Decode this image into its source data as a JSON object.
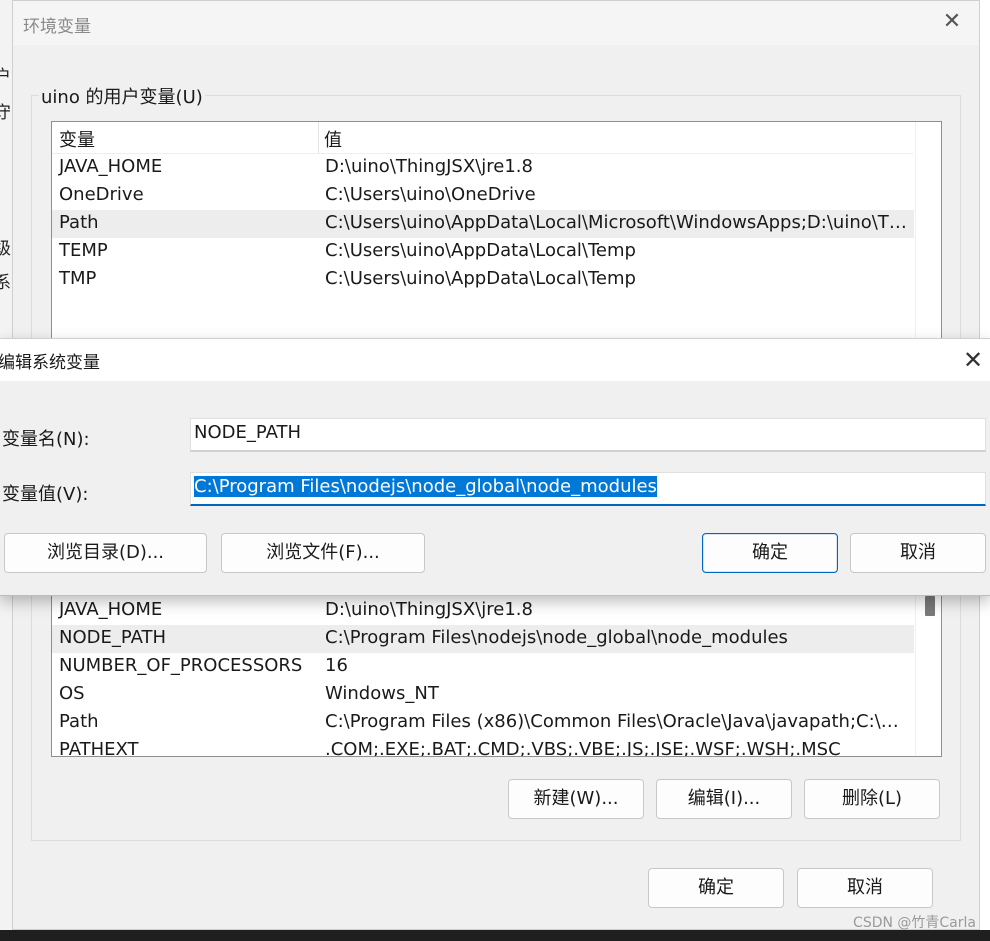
{
  "background": {
    "glyphs": [
      "户",
      "守",
      "级",
      "系"
    ]
  },
  "env_window": {
    "title": "环境变量",
    "close_glyph": "✕",
    "user_group_label": "uino 的用户变量(U)",
    "user_vars": {
      "columns": [
        "变量",
        "值"
      ],
      "rows": [
        {
          "name": "JAVA_HOME",
          "value": "D:\\uino\\ThingJSX\\jre1.8"
        },
        {
          "name": "OneDrive",
          "value": "C:\\Users\\uino\\OneDrive"
        },
        {
          "name": "Path",
          "value": "C:\\Users\\uino\\AppData\\Local\\Microsoft\\WindowsApps;D:\\uino\\Thi..."
        },
        {
          "name": "TEMP",
          "value": "C:\\Users\\uino\\AppData\\Local\\Temp"
        },
        {
          "name": "TMP",
          "value": "C:\\Users\\uino\\AppData\\Local\\Temp"
        }
      ],
      "selected_index": 2
    },
    "system_vars": {
      "rows": [
        {
          "name": "JAVA_HOME",
          "value": "D:\\uino\\ThingJSX\\jre1.8"
        },
        {
          "name": "NODE_PATH",
          "value": "C:\\Program Files\\nodejs\\node_global\\node_modules"
        },
        {
          "name": "NUMBER_OF_PROCESSORS",
          "value": "16"
        },
        {
          "name": "OS",
          "value": "Windows_NT"
        },
        {
          "name": "Path",
          "value": "C:\\Program Files (x86)\\Common Files\\Oracle\\Java\\javapath;C:\\WIN..."
        },
        {
          "name": "PATHEXT",
          "value": ".COM;.EXE;.BAT;.CMD;.VBS;.VBE;.JS;.JSE;.WSF;.WSH;.MSC"
        }
      ],
      "selected_index": 1
    },
    "system_buttons": {
      "new": "新建(W)...",
      "edit": "编辑(I)...",
      "delete": "删除(L)"
    },
    "ok": "确定",
    "cancel": "取消"
  },
  "edit_dialog": {
    "title": "编辑系统变量",
    "close_glyph": "✕",
    "name_label": "变量名(N):",
    "name_value": "NODE_PATH",
    "value_label": "变量值(V):",
    "value_value": "C:\\Program Files\\nodejs\\node_global\\node_modules",
    "browse_dir": "浏览目录(D)...",
    "browse_file": "浏览文件(F)...",
    "ok": "确定",
    "cancel": "取消"
  },
  "watermark": "CSDN @竹青Carla",
  "colors": {
    "accent": "#0067c0",
    "selection": "#0078d7",
    "window_bg": "#f0f0f0"
  }
}
